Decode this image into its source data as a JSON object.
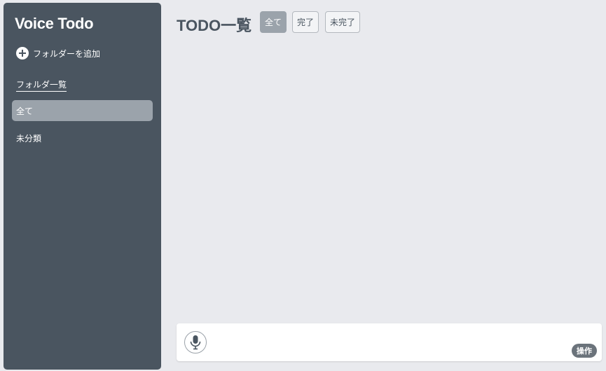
{
  "sidebar": {
    "app_title": "Voice Todo",
    "add_folder_label": "フォルダーを追加",
    "folder_list_label": "フォルダ一覧",
    "items": [
      {
        "label": "全て",
        "active": true
      },
      {
        "label": "未分類",
        "active": false
      }
    ]
  },
  "main": {
    "title": "TODO一覧",
    "filters": [
      {
        "label": "全て",
        "active": true
      },
      {
        "label": "完了",
        "active": false
      },
      {
        "label": "未完了",
        "active": false
      }
    ]
  },
  "input_bar": {
    "mic_icon": "microphone-icon",
    "ops_label": "操作"
  },
  "colors": {
    "sidebar_bg": "#4a5560",
    "page_bg": "#e9eaee",
    "active_item": "#9ba3ab",
    "ops_button": "#6b737b"
  }
}
